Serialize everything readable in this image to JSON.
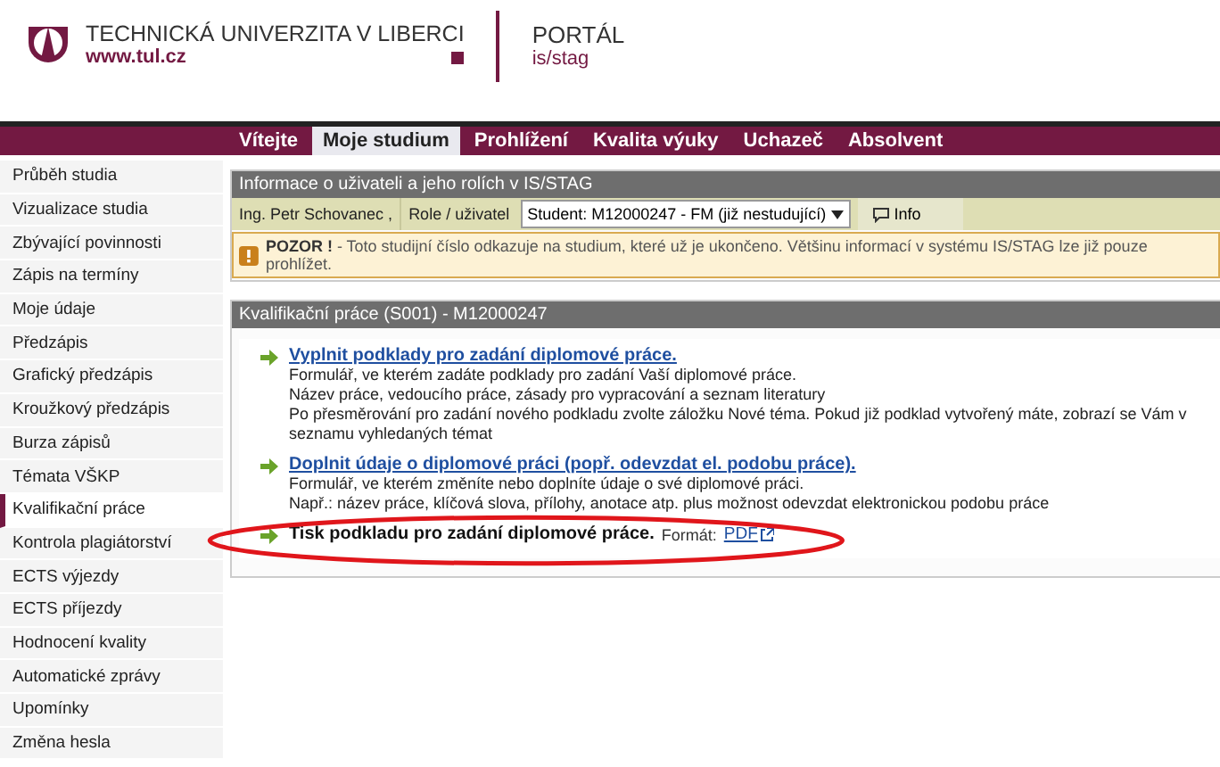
{
  "header": {
    "university": "TECHNICKÁ UNIVERZITA V LIBERCI",
    "website": "www.tul.cz",
    "portal_title": "PORTÁL",
    "portal_subtitle": "is/stag"
  },
  "nav_tabs": [
    {
      "label": "Vítejte",
      "selected": false
    },
    {
      "label": "Moje studium",
      "selected": true
    },
    {
      "label": "Prohlížení",
      "selected": false
    },
    {
      "label": "Kvalita výuky",
      "selected": false
    },
    {
      "label": "Uchazeč",
      "selected": false
    },
    {
      "label": "Absolvent",
      "selected": false
    }
  ],
  "sidebar": {
    "items": [
      {
        "label": "Průběh studia",
        "selected": false
      },
      {
        "label": "Vizualizace studia",
        "selected": false
      },
      {
        "label": "Zbývající povinnosti",
        "selected": false
      },
      {
        "label": "Zápis na termíny",
        "selected": false
      },
      {
        "label": "Moje údaje",
        "selected": false
      },
      {
        "label": "Předzápis",
        "selected": false
      },
      {
        "label": "Grafický předzápis",
        "selected": false
      },
      {
        "label": "Kroužkový předzápis",
        "selected": false
      },
      {
        "label": "Burza zápisů",
        "selected": false
      },
      {
        "label": "Témata VŠKP",
        "selected": false
      },
      {
        "label": "Kvalifikační práce",
        "selected": true
      },
      {
        "label": "Kontrola plagiátorství",
        "selected": false
      },
      {
        "label": "ECTS výjezdy",
        "selected": false
      },
      {
        "label": "ECTS příjezdy",
        "selected": false
      },
      {
        "label": "Hodnocení kvality",
        "selected": false
      },
      {
        "label": "Automatické zprávy",
        "selected": false
      },
      {
        "label": "Upomínky",
        "selected": false
      },
      {
        "label": "Změna hesla",
        "selected": false
      }
    ]
  },
  "user_panel": {
    "title": "Informace o uživateli a jeho rolích v IS/STAG",
    "user_name": "Ing. Petr Schovanec ,",
    "role_label": "Role / uživatel",
    "role_value": "Student: M12000247 - FM (již nestudující)",
    "info_button": "Info",
    "warning": {
      "label": "POZOR !",
      "text": " - Toto studijní číslo odkazuje na studium, které už je ukončeno. Většinu informací v systému IS/STAG lze již pouze prohlížet."
    }
  },
  "thesis_panel": {
    "title": "Kvalifikační práce (S001) - M12000247",
    "entries": [
      {
        "kind": "link",
        "title": "Vyplnit podklady pro zadání diplomové práce.",
        "lines": [
          "Formulář, ve kterém zadáte podklady pro zadání Vaší diplomové práce.",
          "Název práce, vedoucího práce, zásady pro vypracování a seznam literatury",
          "Po přesměrování pro zadání nového podkladu zvolte záložku Nové téma. Pokud již podklad vytvořený máte, zobrazí se Vám v seznamu vyhledaných témat"
        ]
      },
      {
        "kind": "link",
        "title": "Doplnit údaje o diplomové práci (popř. odevzdat el. podobu práce).",
        "lines": [
          "Formulář, ve kterém změníte nebo doplníte údaje o své diplomové práci.",
          "Např.: název práce, klíčová slova, přílohy, anotace atp. plus možnost odevzdat elektronickou podobu práce"
        ]
      },
      {
        "kind": "print",
        "title": "Tisk podkladu pro zadání diplomové práce.",
        "format_label": "Formát:",
        "format_link": "PDF",
        "highlighted": true
      }
    ]
  }
}
